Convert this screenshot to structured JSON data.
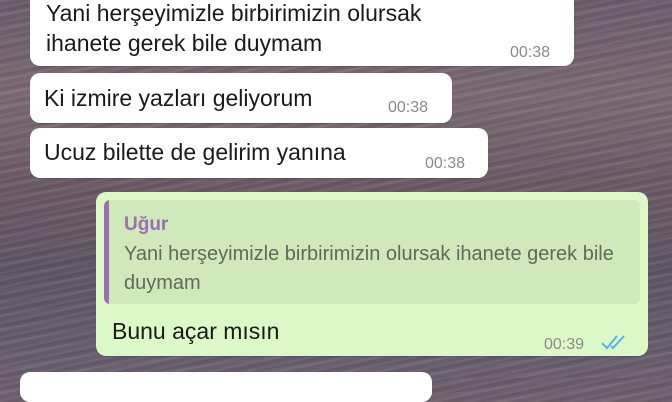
{
  "messages": [
    {
      "line1": "Yani herşeyimizle birbirimizin olursak",
      "line2": "ihanete gerek bile duymam",
      "time": "00:38"
    },
    {
      "text": "Ki izmire yazları geliyorum",
      "time": "00:38"
    },
    {
      "text": "Ucuz bilette de gelirim yanına",
      "time": "00:38"
    }
  ],
  "reply": {
    "quote_author": "Uğur",
    "quote_text": "Yani herşeyimizle birbirimizin olursak ihanete gerek bile duymam",
    "text": "Bunu açar mısın",
    "time": "00:39",
    "status": "read",
    "tick_icon": "double-check-icon",
    "tick_color": "#4fb6ec"
  },
  "colors": {
    "incoming_bubble": "#ffffff",
    "outgoing_bubble": "#dcf8c6",
    "quote_accent": "#9b6fb0"
  }
}
